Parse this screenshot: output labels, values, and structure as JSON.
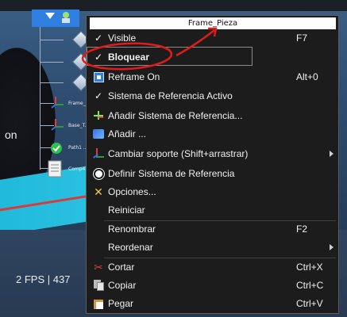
{
  "viewport": {
    "side_text": "on",
    "fps_text": "2 FPS | 437"
  },
  "tree": {
    "labels": [
      "Frame_...",
      "Base_T...",
      "Path1 ...",
      "Comp4..."
    ]
  },
  "menu": {
    "title": "Frame_Pieza",
    "items": [
      {
        "label": "Visible",
        "shortcut": "F7",
        "checked": true,
        "icon": "check-icon"
      },
      {
        "label": "Bloquear",
        "shortcut": "",
        "checked": true,
        "icon": "check-icon"
      },
      {
        "label": "Reframe On",
        "shortcut": "Alt+0",
        "icon": "reframe-icon"
      },
      {
        "label": "Sistema de Referencia Activo",
        "shortcut": "",
        "checked": true,
        "icon": "check-icon"
      },
      {
        "label": "Añadir Sistema de Referencia...",
        "shortcut": "",
        "icon": "add-frame-icon"
      },
      {
        "label": "Añadir ...",
        "shortcut": "",
        "icon": "add-object-icon"
      },
      {
        "label": "Cambiar soporte (Shift+arrastrar)",
        "shortcut": "",
        "submenu": true,
        "icon": "axes-icon"
      },
      {
        "label": "Definir Sistema de Referencia",
        "shortcut": "",
        "icon": "gear-icon"
      },
      {
        "label": "Opciones...",
        "shortcut": "",
        "icon": "tools-icon"
      },
      {
        "label": "Reiniciar",
        "shortcut": ""
      },
      {
        "label": "Renombrar",
        "shortcut": "F2"
      },
      {
        "label": "Reordenar",
        "shortcut": "",
        "submenu": true
      },
      {
        "label": "Cortar",
        "shortcut": "Ctrl+X",
        "icon": "scissors-icon"
      },
      {
        "label": "Copiar",
        "shortcut": "Ctrl+C",
        "icon": "copy-icon"
      },
      {
        "label": "Pegar",
        "shortcut": "Ctrl+V",
        "icon": "paste-icon"
      }
    ]
  },
  "colors": {
    "menu_bg": "#1c1c1c",
    "menu_text": "#f1f1f1",
    "accent_blue": "#2f7fe0",
    "annotation_red": "#e01b1b"
  }
}
